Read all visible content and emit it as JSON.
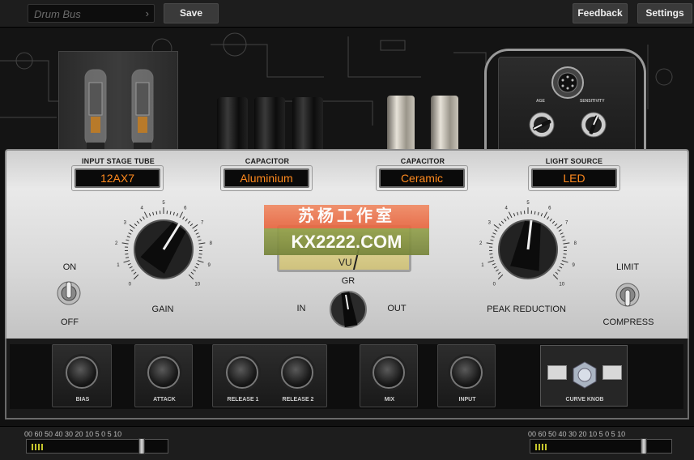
{
  "topbar": {
    "preset_name": "Drum Bus",
    "save_label": "Save",
    "feedback_label": "Feedback",
    "settings_label": "Settings"
  },
  "selectors": {
    "input_stage_tube": {
      "label": "INPUT STAGE TUBE",
      "value": "12AX7"
    },
    "capacitor_1": {
      "label": "CAPACITOR",
      "value": "Aluminium"
    },
    "capacitor_2": {
      "label": "CAPACITOR",
      "value": "Ceramic"
    },
    "light_source": {
      "label": "LIGHT SOURCE",
      "value": "LED"
    }
  },
  "lightbox": {
    "age_label": "AGE",
    "sensitivity_label": "SENSITIVITY"
  },
  "gain": {
    "label": "GAIN",
    "ticks": [
      "0",
      "1",
      "2",
      "3",
      "4",
      "5",
      "6",
      "7",
      "8",
      "9",
      "10"
    ]
  },
  "peak_reduction": {
    "label": "PEAK REDUCTION",
    "ticks": [
      "0",
      "1",
      "2",
      "3",
      "4",
      "5",
      "6",
      "7",
      "8",
      "9",
      "10"
    ]
  },
  "power_switch": {
    "on_label": "ON",
    "off_label": "OFF"
  },
  "mode_switch": {
    "limit_label": "LIMIT",
    "compress_label": "COMPRESS"
  },
  "meter_selector": {
    "gr_label": "GR",
    "in_label": "IN",
    "out_label": "OUT"
  },
  "vu_meter": {
    "label": "VU"
  },
  "watermark": {
    "line1": "苏杨工作室",
    "line2": "KX2222.COM"
  },
  "bottom_knobs": {
    "bias": "BIAS",
    "attack": "ATTACK",
    "release1": "RELEASE 1",
    "release2": "RELEASE 2",
    "mix": "MIX",
    "input": "INPUT",
    "curve": "CURVE KNOB"
  },
  "io_meters": {
    "scale": "00 60 50 40  30   20   10  5  0   5   10",
    "input_fader_db": 0,
    "output_fader_db": 0
  },
  "colors": {
    "display_text": "#ff8a1e",
    "panel": "#dcdcdc",
    "chrome": "#1d1d1d"
  }
}
